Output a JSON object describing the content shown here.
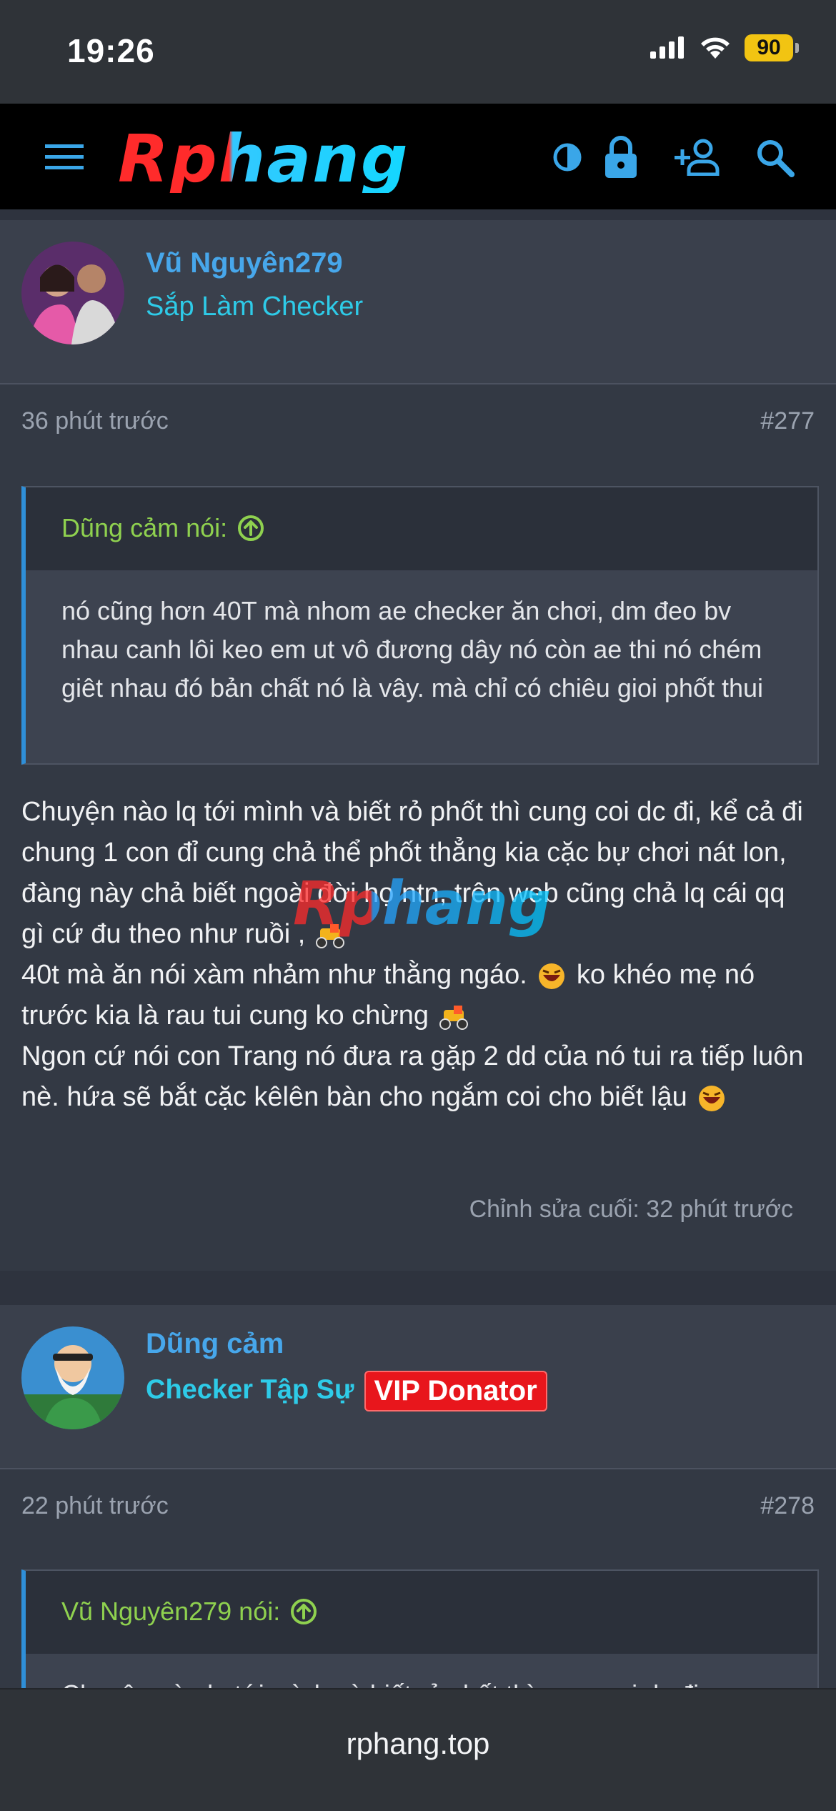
{
  "status_bar": {
    "time": "19:26",
    "battery": "90"
  },
  "site": {
    "logo_text": "Rphang"
  },
  "posts": [
    {
      "username": "Vũ Nguyên279",
      "user_title": "Sắp Làm Checker",
      "time_ago": "36 phút trước",
      "post_number": "#277",
      "quote": {
        "author": "Dũng cảm nói:",
        "text": "nó cũng hơn 40T mà nhom ae checker ăn chơi, dm đeo bv nhau canh lôi keo em ut vô đương dây nó còn ae thi nó chém giêt nhau đó bản chất nó là vây. mà chỉ có chiêu gioi phốt thui"
      },
      "body_lines": [
        "Chuyện nào lq tới mình và biết rỏ phốt thì cung coi dc đi, kể cả đi chung 1 con đỉ cung chả thể phốt thẳng kia cặc bự chơi nát lon, đàng này chả biết ngoài đời họ ntn, trên web cũng chả lq cái qq gì cứ đu theo như ruồi ,",
        "40t mà ăn nói xàm nhảm như thằng ngáo.",
        "ko khéo mẹ nó trước kia là rau tui cung ko chừng",
        "Ngon cứ nói con Trang nó đưa ra gặp 2 dd của nó tui ra tiếp luôn nè. hứa sẽ bắt cặc kêlên bàn cho ngắm coi cho biết lậu"
      ],
      "edited": "Chỉnh sửa cuối: 32 phút trước"
    },
    {
      "username": "Dũng cảm",
      "user_title": "Checker Tập Sự",
      "badge": "VIP Donator",
      "time_ago": "22 phút trước",
      "post_number": "#278",
      "quote": {
        "author": "Vũ Nguyên279 nói:",
        "text": "Chuyện nào lq tới mình và biết rỏ phốt thì cung coi dc đi"
      }
    }
  ],
  "browser": {
    "url": "rphang.top"
  },
  "colors": {
    "accent": "#47a7eb",
    "quote_author": "#8fd14f",
    "badge": "#e8161c"
  },
  "icons": [
    "menu-icon",
    "theme-toggle-icon",
    "lock-icon",
    "add-user-icon",
    "search-icon",
    "arrow-up-circle-icon"
  ]
}
